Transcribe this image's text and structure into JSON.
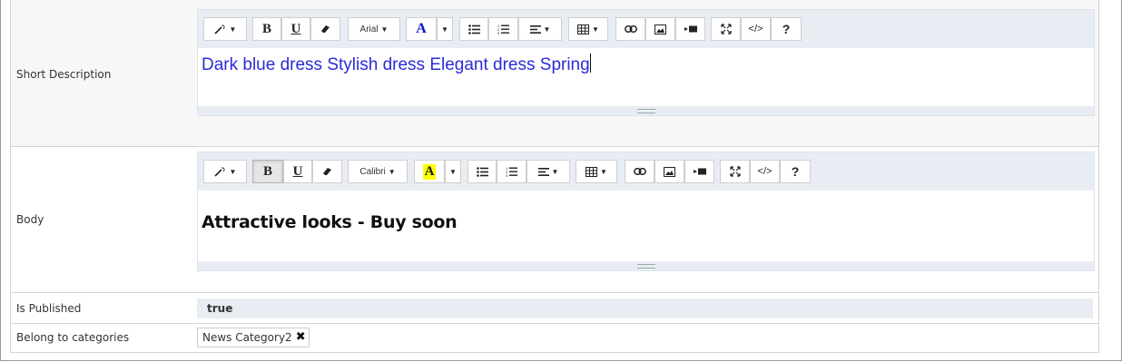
{
  "fields": {
    "short_description": {
      "label": "Short Description",
      "font_name": "Arial",
      "content": "Dark blue dress Stylish dress Elegant dress Spring"
    },
    "body": {
      "label": "Body",
      "font_name": "Calibri",
      "content": "Attractive looks - Buy soon"
    },
    "is_published": {
      "label": "Is Published",
      "value": "true"
    },
    "categories": {
      "label": "Belong to categories",
      "tags": [
        "News Category2"
      ]
    }
  },
  "toolbar_icons": {
    "style": "magic-wand-icon",
    "bold": "B",
    "underline": "U",
    "clear": "eraser-icon",
    "color": "A",
    "help": "?",
    "codeview": "</>"
  },
  "colors": {
    "short_text_color": "#2b2bd8",
    "highlight_color": "#ffff00",
    "font_color_icon": "#1010cc"
  }
}
